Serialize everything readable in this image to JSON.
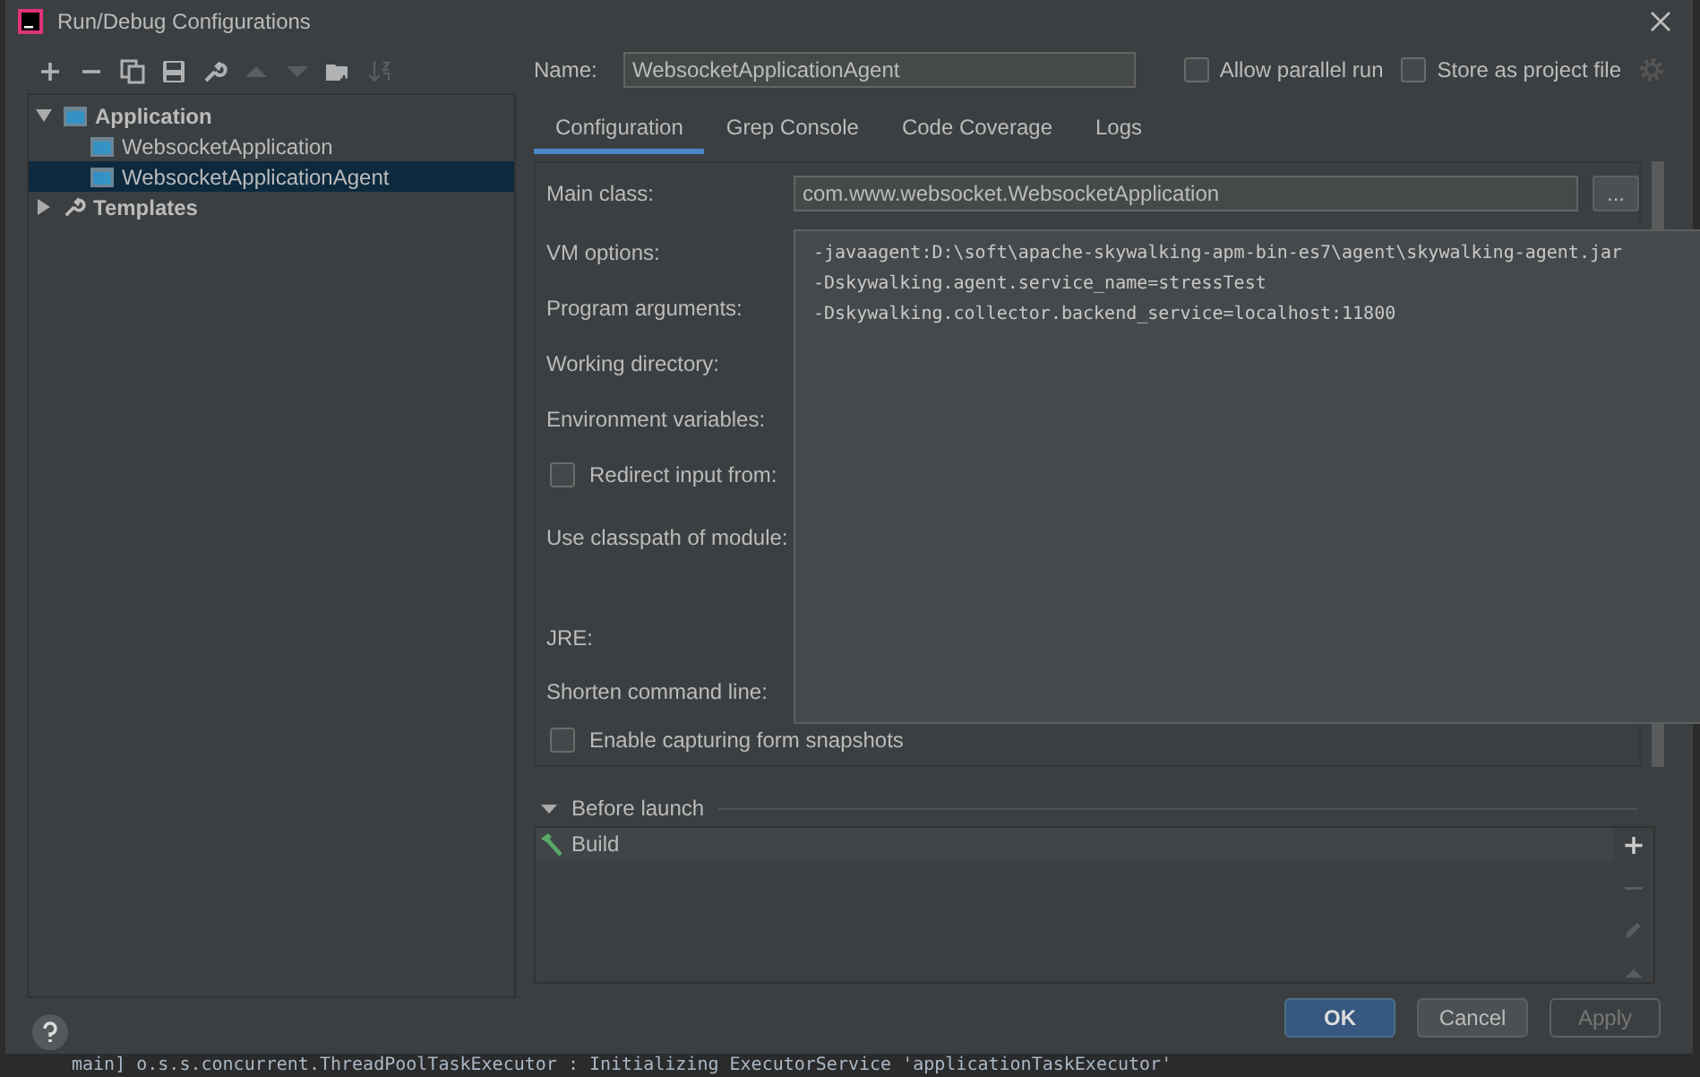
{
  "window": {
    "title": "Run/Debug Configurations"
  },
  "toolbar": [
    {
      "kind": "add",
      "disabled": false
    },
    {
      "kind": "remove",
      "disabled": false
    },
    {
      "kind": "copy",
      "disabled": false
    },
    {
      "kind": "save",
      "disabled": false
    },
    {
      "kind": "wrench",
      "disabled": false
    },
    {
      "kind": "up",
      "disabled": true
    },
    {
      "kind": "down",
      "disabled": true
    },
    {
      "kind": "folder",
      "disabled": false
    },
    {
      "kind": "sort",
      "disabled": true
    }
  ],
  "tree": [
    {
      "label": "Application",
      "kind": "app",
      "expanded": true,
      "selected": false,
      "children": [
        {
          "label": "WebsocketApplication",
          "kind": "app",
          "selected": false
        },
        {
          "label": "WebsocketApplicationAgent",
          "kind": "app",
          "selected": true
        }
      ]
    },
    {
      "label": "Templates",
      "kind": "wrench",
      "expanded": false,
      "selected": false
    }
  ],
  "name": {
    "label": "Name:",
    "value": "WebsocketApplicationAgent"
  },
  "options": [
    {
      "label": "Allow parallel run",
      "checked": false
    },
    {
      "label": "Store as project file",
      "checked": false
    }
  ],
  "tabs": [
    {
      "label": "Configuration",
      "selected": true
    },
    {
      "label": "Grep Console",
      "selected": false
    },
    {
      "label": "Code Coverage",
      "selected": false
    },
    {
      "label": "Logs",
      "selected": false
    }
  ],
  "main_class": {
    "label": "Main class:",
    "value": "com.www.websocket.WebsocketApplication",
    "browse": "..."
  },
  "fields": [
    {
      "label": "VM options:",
      "kind": "label"
    },
    {
      "label": "Program arguments:",
      "kind": "label"
    },
    {
      "label": "Working directory:",
      "kind": "label"
    },
    {
      "label": "Environment variables:",
      "kind": "label"
    },
    {
      "label": "Redirect input from:",
      "kind": "checkbox",
      "checked": false
    },
    {
      "label": "Use classpath of module:",
      "kind": "tall"
    },
    {
      "label": "JRE:",
      "kind": "label"
    },
    {
      "label": "Shorten command line:",
      "kind": "label"
    },
    {
      "label": "Enable capturing form snapshots",
      "kind": "checkbox",
      "checked": false
    }
  ],
  "vm_popup": {
    "lines": [
      "-javaagent:D:\\soft\\apache-skywalking-apm-bin-es7\\agent\\skywalking-agent.jar",
      "-Dskywalking.agent.service_name=stressTest",
      "-Dskywalking.collector.backend_service=localhost:11800"
    ]
  },
  "before_launch": {
    "title": "Before launch",
    "expanded": true,
    "tasks": [
      {
        "label": "Build",
        "selected": true
      }
    ],
    "actions": [
      {
        "kind": "add",
        "disabled": false
      },
      {
        "kind": "remove",
        "disabled": true
      },
      {
        "kind": "edit",
        "disabled": true
      },
      {
        "kind": "up",
        "disabled": true
      }
    ]
  },
  "buttons": [
    {
      "label": "OK",
      "kind": "primary"
    },
    {
      "label": "Cancel",
      "kind": "normal"
    },
    {
      "label": "Apply",
      "kind": "disabled"
    }
  ],
  "background_console": "main] o.s.s.concurrent.ThreadPoolTaskExecutor  : Initializing ExecutorService 'applicationTaskExecutor'"
}
